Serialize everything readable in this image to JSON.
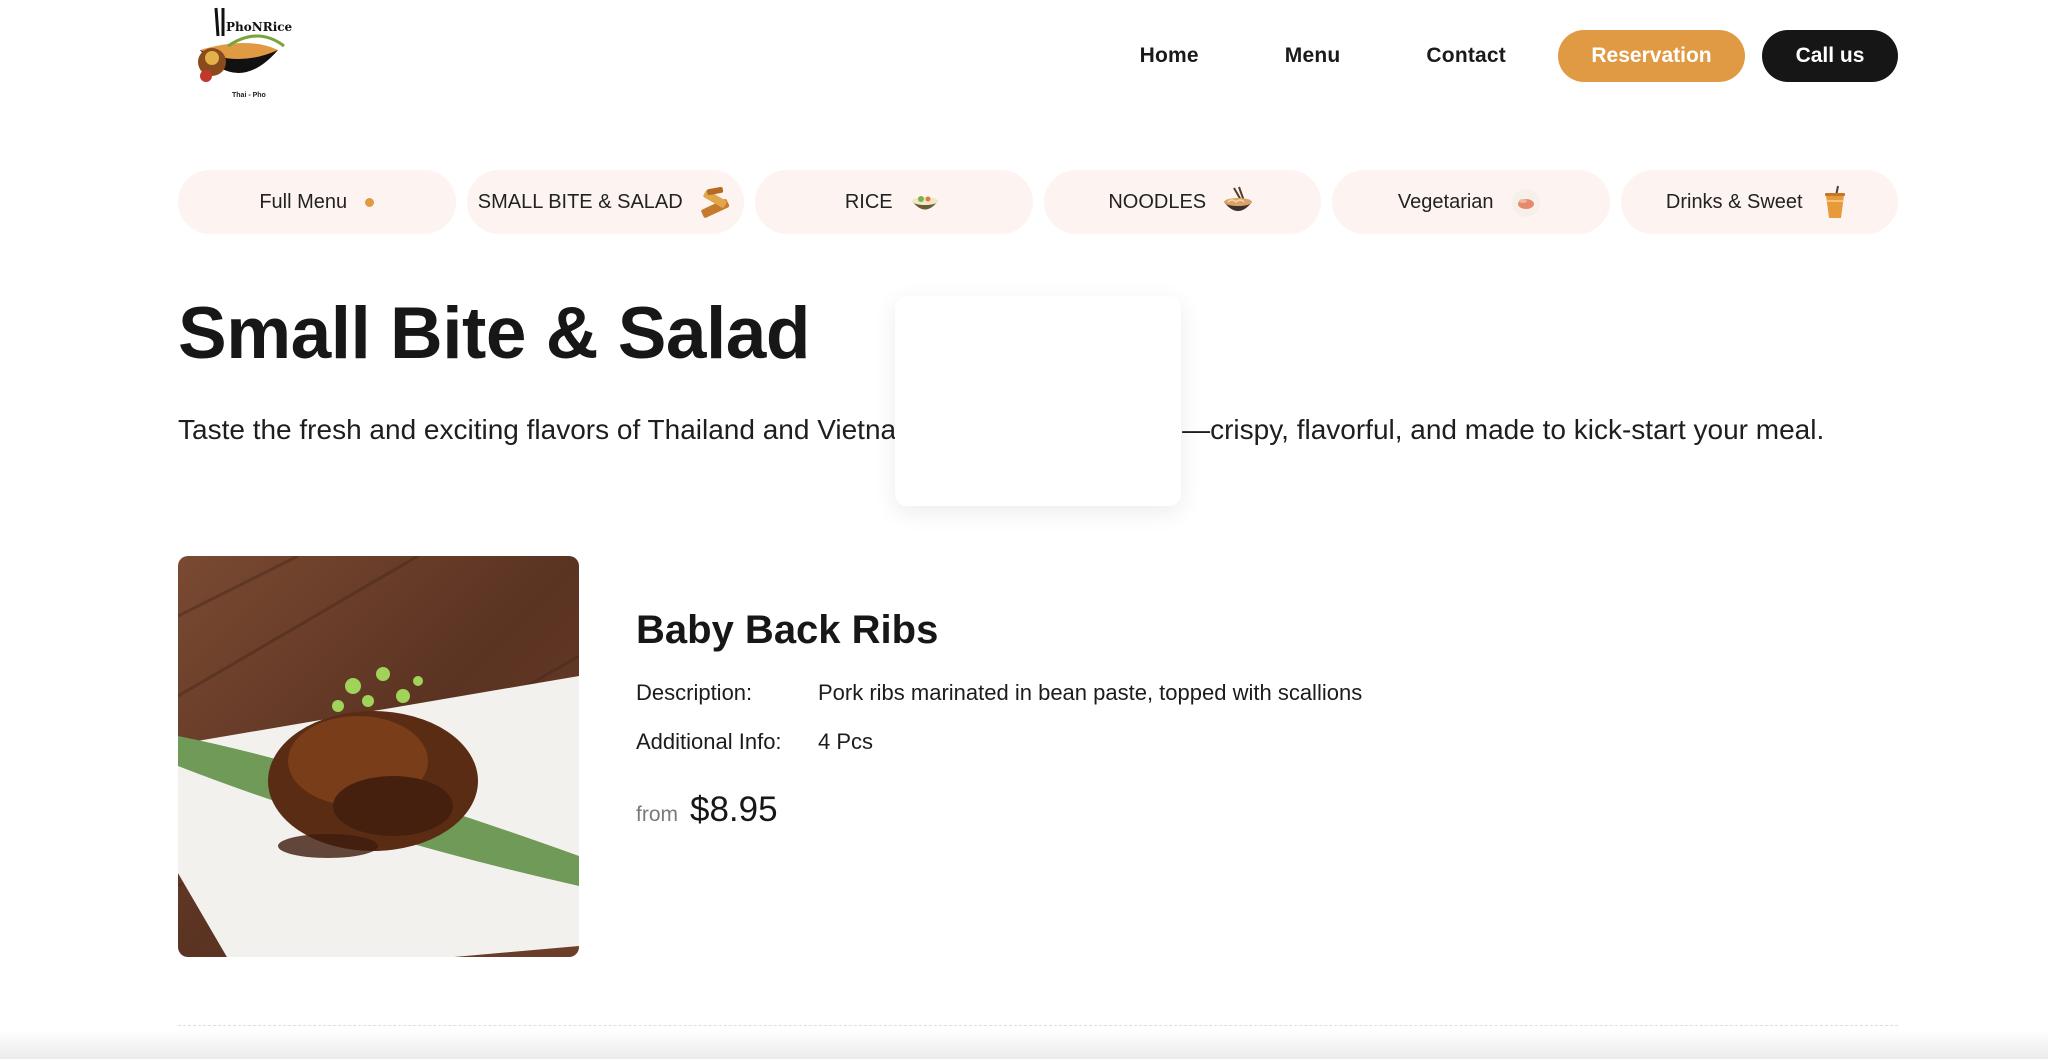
{
  "brand": {
    "logo_text": "PhoNRice",
    "logo_sub": "Thai - Pho"
  },
  "nav": {
    "links": [
      "Home",
      "Menu",
      "Contact"
    ],
    "reservation_label": "Reservation",
    "call_label": "Call us"
  },
  "categories": [
    {
      "label": "Full Menu",
      "icon": "dot-indicator"
    },
    {
      "label": "SMALL BITE & SALAD",
      "icon": "spring-roll-icon"
    },
    {
      "label": "RICE",
      "icon": "rice-bowl-icon"
    },
    {
      "label": "NOODLES",
      "icon": "noodle-bowl-icon"
    },
    {
      "label": "Vegetarian",
      "icon": "vegetarian-plate-icon"
    },
    {
      "label": "Drinks & Sweet",
      "icon": "drink-cup-icon"
    }
  ],
  "section": {
    "title": "Small Bite & Salad",
    "description_start": "Taste the fresh and exciting flavors of Thailand and Vietna",
    "description_end": "—crispy, flavorful, and made to kick-start your meal."
  },
  "item": {
    "name": "Baby Back Ribs",
    "description_label": "Description:",
    "description": "Pork ribs marinated in bean paste, topped with scallions",
    "info_label": "Additional Info:",
    "info": "4 Pcs",
    "price_prefix": "from",
    "price": "$8.95"
  },
  "colors": {
    "accent": "#e19a44",
    "dark": "#161616",
    "tab_bg": "#fdf4f1"
  }
}
